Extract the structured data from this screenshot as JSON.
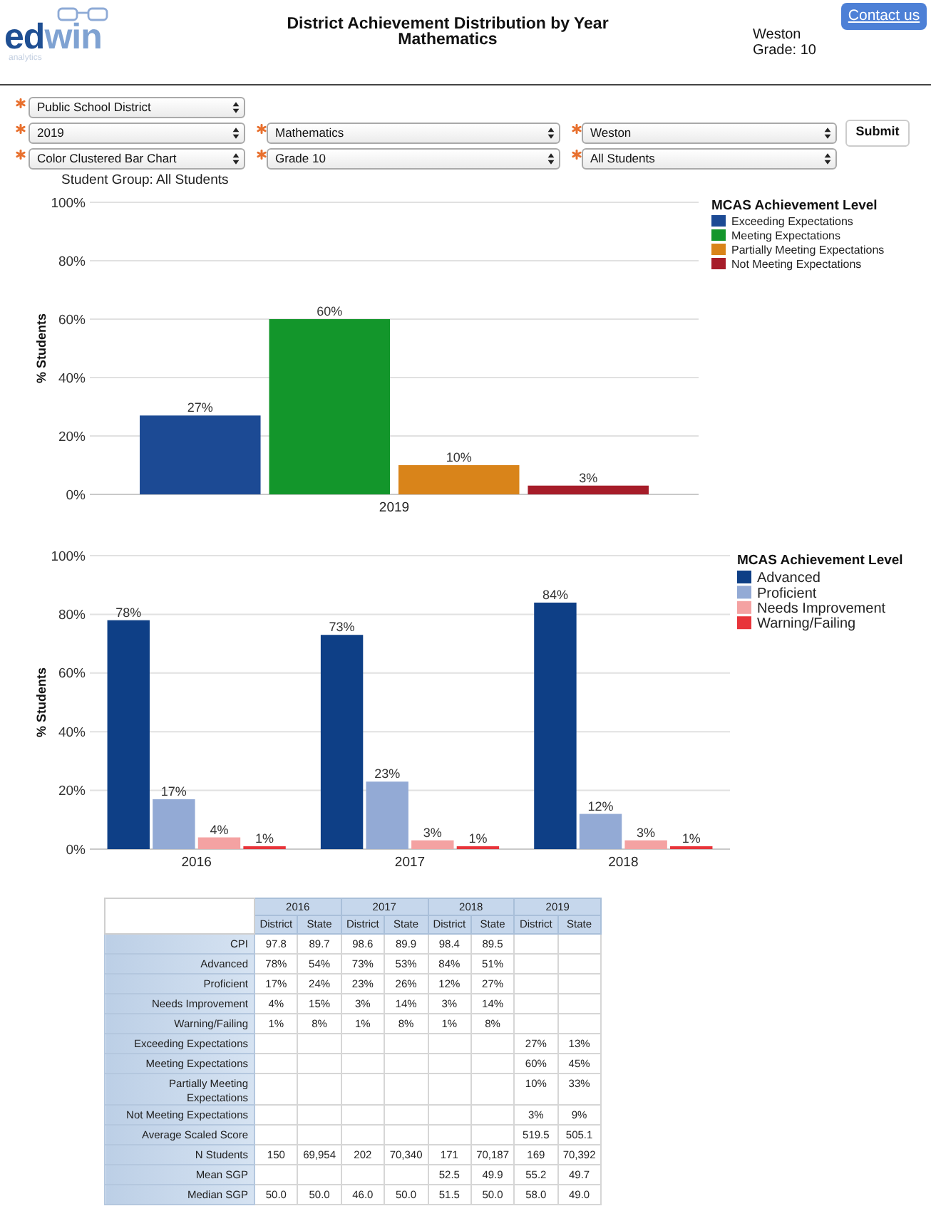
{
  "header": {
    "logo": {
      "parts": [
        "ed",
        "win"
      ],
      "tagline": "analytics"
    },
    "title": "District Achievement Distribution by Year",
    "subtitle": "Mathematics",
    "district": "Weston",
    "grade": "Grade: 10",
    "contact_button": "Contact us"
  },
  "filters": [
    [
      {
        "value": "Public School District",
        "required": true
      }
    ],
    [
      {
        "value": "2019",
        "required": true
      },
      {
        "value": "Mathematics",
        "required": true
      },
      {
        "value": "Weston",
        "required": true
      }
    ],
    [
      {
        "value": "Color Clustered Bar Chart",
        "required": true
      },
      {
        "value": "Grade 10",
        "required": true
      },
      {
        "value": "All Students",
        "required": true
      }
    ]
  ],
  "submit_button": "Submit",
  "student_group": "Student Group: All Students",
  "charts": [
    {
      "chart_data": {
        "type": "bar",
        "ylabel": "% Students",
        "categories": [
          "2019"
        ],
        "series": [
          {
            "name": "Exceeding Expectations",
            "color": "#1c4a94",
            "values": [
              27
            ],
            "value_labels": [
              "27%"
            ]
          },
          {
            "name": "Meeting Expectations",
            "color": "#13962b",
            "values": [
              60
            ],
            "value_labels": [
              "60%"
            ]
          },
          {
            "name": "Partially Meeting Expectations",
            "color": "#d9841a",
            "values": [
              10
            ],
            "value_labels": [
              "10%"
            ]
          },
          {
            "name": "Not Meeting Expectations",
            "color": "#a61c29",
            "values": [
              3
            ],
            "value_labels": [
              "3%"
            ]
          }
        ],
        "ylim": [
          0,
          100
        ],
        "yticks": [
          {
            "value": 0,
            "label": "0%"
          },
          {
            "value": 20,
            "label": "20%"
          },
          {
            "value": 40,
            "label": "40%"
          },
          {
            "value": 60,
            "label": "60%"
          },
          {
            "value": 80,
            "label": "80%"
          },
          {
            "value": 100,
            "label": "100%"
          }
        ],
        "grid": true,
        "legend": {
          "title": "MCAS Achievement Level"
        }
      }
    },
    {
      "chart_data": {
        "type": "bar",
        "ylabel": "% Students",
        "categories": [
          "2016",
          "2017",
          "2018"
        ],
        "series": [
          {
            "name": "Advanced",
            "color": "#0e3f86",
            "values": [
              78,
              73,
              84
            ],
            "value_labels": [
              "78%",
              "73%",
              "84%"
            ]
          },
          {
            "name": "Proficient",
            "color": "#93aad5",
            "values": [
              17,
              23,
              12
            ],
            "value_labels": [
              "17%",
              "23%",
              "12%"
            ]
          },
          {
            "name": "Needs Improvement",
            "color": "#f4a2a2",
            "values": [
              4,
              3,
              3
            ],
            "value_labels": [
              "4%",
              "3%",
              "3%"
            ]
          },
          {
            "name": "Warning/Failing",
            "color": "#e8343a",
            "values": [
              1,
              1,
              1
            ],
            "value_labels": [
              "1%",
              "1%",
              "1%"
            ]
          }
        ],
        "ylim": [
          0,
          100
        ],
        "yticks": [
          {
            "value": 0,
            "label": "0%"
          },
          {
            "value": 20,
            "label": "20%"
          },
          {
            "value": 40,
            "label": "40%"
          },
          {
            "value": 60,
            "label": "60%"
          },
          {
            "value": 80,
            "label": "80%"
          },
          {
            "value": 100,
            "label": "100%"
          }
        ],
        "grid": true,
        "legend": {
          "title": "MCAS Achievement Level"
        }
      }
    }
  ],
  "table": {
    "column_groups": [
      {
        "year": "2016",
        "columns": [
          "District",
          "State"
        ]
      },
      {
        "year": "2017",
        "columns": [
          "District",
          "State"
        ]
      },
      {
        "year": "2018",
        "columns": [
          "District",
          "State"
        ]
      },
      {
        "year": "2019",
        "columns": [
          "District",
          "State"
        ]
      }
    ],
    "rows": [
      {
        "label": "CPI",
        "cells": [
          "97.8",
          "89.7",
          "98.6",
          "89.9",
          "98.4",
          "89.5",
          null,
          null
        ]
      },
      {
        "label": "Advanced",
        "cells": [
          "78%",
          "54%",
          "73%",
          "53%",
          "84%",
          "51%",
          null,
          null
        ]
      },
      {
        "label": "Proficient",
        "cells": [
          "17%",
          "24%",
          "23%",
          "26%",
          "12%",
          "27%",
          null,
          null
        ]
      },
      {
        "label": "Needs Improvement",
        "cells": [
          "4%",
          "15%",
          "3%",
          "14%",
          "3%",
          "14%",
          null,
          null
        ]
      },
      {
        "label": "Warning/Failing",
        "cells": [
          "1%",
          "8%",
          "1%",
          "8%",
          "1%",
          "8%",
          null,
          null
        ]
      },
      {
        "label": "Exceeding Expectations",
        "cells": [
          null,
          null,
          null,
          null,
          null,
          null,
          "27%",
          "13%"
        ]
      },
      {
        "label": "Meeting Expectations",
        "cells": [
          null,
          null,
          null,
          null,
          null,
          null,
          "60%",
          "45%"
        ]
      },
      {
        "label": "Partially Meeting Expectations",
        "cells": [
          null,
          null,
          null,
          null,
          null,
          null,
          "10%",
          "33%"
        ]
      },
      {
        "label": "Not Meeting Expectations",
        "cells": [
          null,
          null,
          null,
          null,
          null,
          null,
          "3%",
          "9%"
        ]
      },
      {
        "label": "Average Scaled Score",
        "cells": [
          null,
          null,
          null,
          null,
          null,
          null,
          "519.5",
          "505.1"
        ]
      },
      {
        "label": "N Students",
        "cells": [
          "150",
          "69,954",
          "202",
          "70,340",
          "171",
          "70,187",
          "169",
          "70,392"
        ]
      },
      {
        "label": "Mean SGP",
        "cells": [
          null,
          null,
          null,
          null,
          "52.5",
          "49.9",
          "55.2",
          "49.7"
        ]
      },
      {
        "label": "Median SGP",
        "cells": [
          "50.0",
          "50.0",
          "46.0",
          "50.0",
          "51.5",
          "50.0",
          "58.0",
          "49.0"
        ]
      }
    ]
  }
}
